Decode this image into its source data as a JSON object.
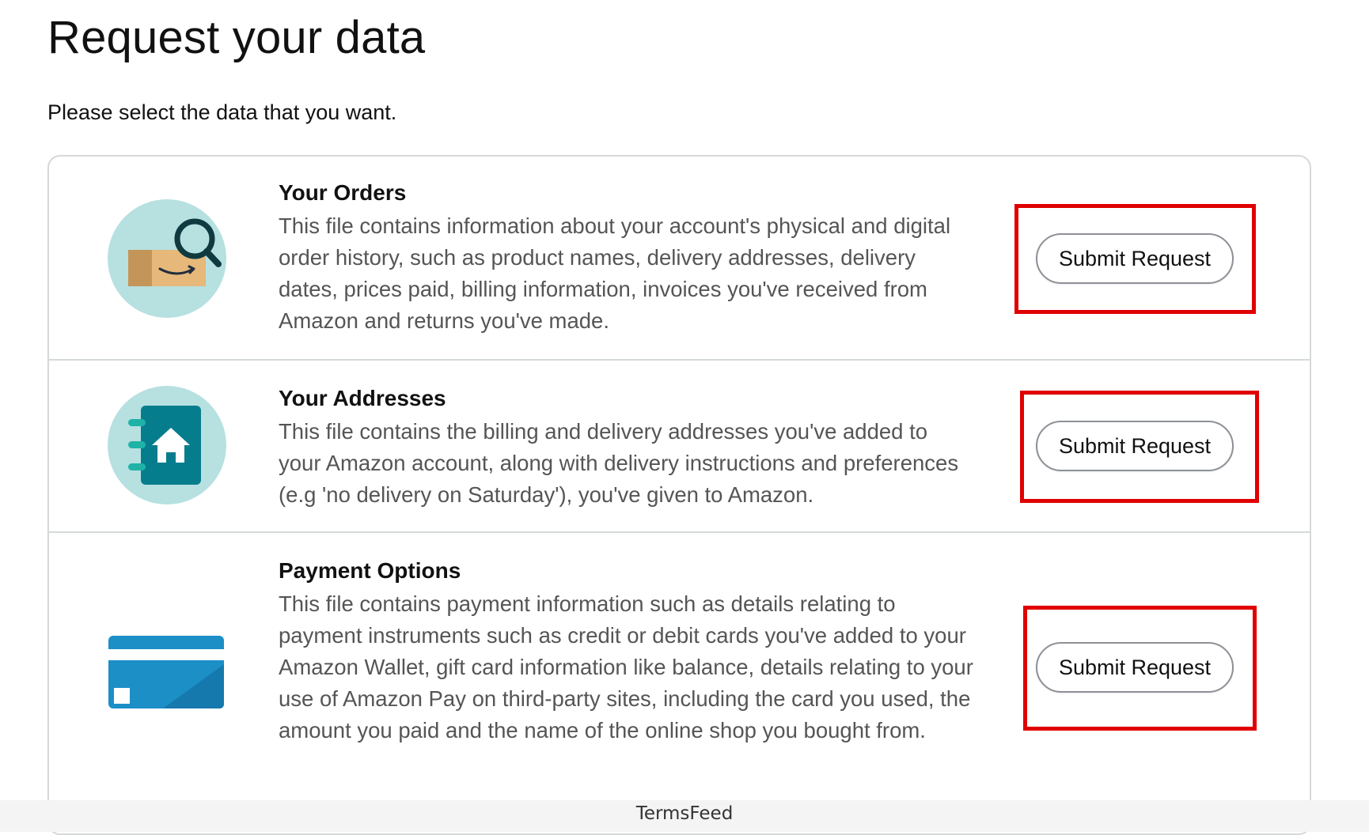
{
  "page": {
    "title": "Request your data",
    "subtitle": "Please select the data that you want."
  },
  "items": [
    {
      "title": "Your Orders",
      "description": "This file contains information about your account's physical and digital order history, such as product names, delivery addresses, delivery dates, prices paid, billing information, invoices you've received from Amazon and returns you've made.",
      "button_label": "Submit Request",
      "icon": "orders-package-magnifier-icon"
    },
    {
      "title": "Your Addresses",
      "description": "This file contains the billing and delivery addresses you've added to your Amazon account, along with delivery instructions and preferences (e.g 'no delivery on Saturday'), you've given to Amazon.",
      "button_label": "Submit Request",
      "icon": "address-book-house-icon"
    },
    {
      "title": "Payment Options",
      "description": "This file contains payment information such as details relating to payment instruments such as credit or debit cards you've added to your Amazon Wallet, gift card information like balance, details relating to your use of Amazon Pay on third-party sites, including the card you used, the amount you paid and the name of the online shop you bought from.",
      "button_label": "Submit Request",
      "icon": "credit-card-icon"
    }
  ],
  "footer": {
    "text": "TermsFeed"
  },
  "colors": {
    "highlight": "#e00000",
    "icon_circle": "#b7e0e0",
    "teal": "#067d8d",
    "card_blue": "#1c8fc7"
  }
}
